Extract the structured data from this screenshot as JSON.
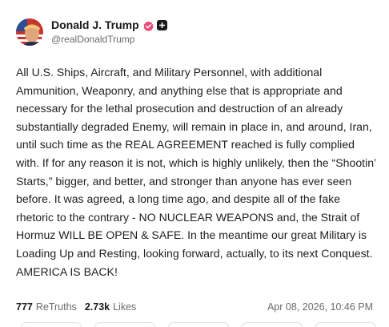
{
  "author": {
    "display_name": "Donald J. Trump",
    "handle": "@realDonaldTrump"
  },
  "icons": {
    "verified": "verified-badge-icon",
    "plus_badge": "plus-badge-icon",
    "avatar": "profile-avatar"
  },
  "colors": {
    "verified_badge": "#e84d79",
    "text": "#1f1f1f",
    "muted": "#6b6b6b"
  },
  "post": {
    "text": "All U.S. Ships, Aircraft, and Military Personnel, with additional Ammunition, Weaponry, and anything else that is appropriate and necessary for the lethal prosecution and destruction of an already substantially degraded Enemy, will remain in place in, and around, Iran, until such time as the REAL AGREEMENT reached is fully complied with. If for any reason it is not, which is highly unlikely, then the “Shootin’ Starts,” bigger, and better, and stronger than anyone has ever seen before. It was agreed, a long time ago, and despite all of the fake rhetoric to the contrary - NO NUCLEAR WEAPONS and, the Strait of Hormuz WILL BE OPEN & SAFE. In the meantime our great Military is Loading Up and Resting, looking forward, actually, to its next Conquest. AMERICA IS BACK!"
  },
  "stats": {
    "retruths_count": "777",
    "retruths_label": "ReTruths",
    "likes_count": "2.73k",
    "likes_label": "Likes",
    "timestamp": "Apr 08, 2026, 10:46 PM"
  }
}
